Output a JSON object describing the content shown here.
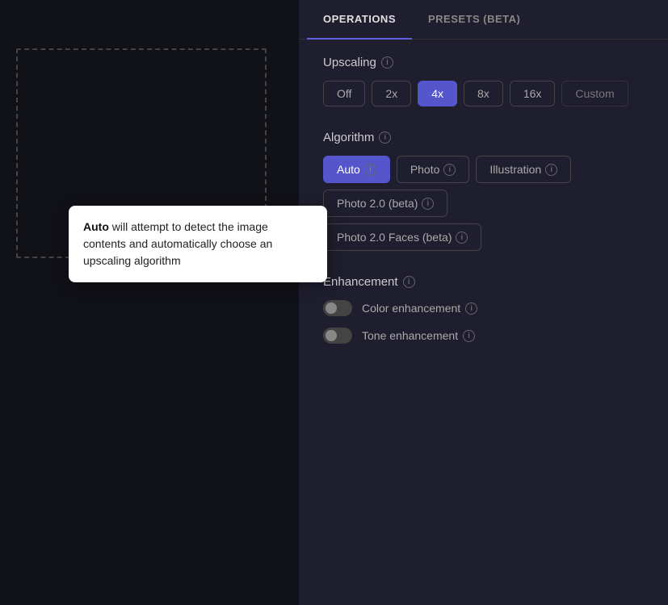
{
  "tabs": {
    "operations": {
      "label": "OPERATIONS",
      "active": true
    },
    "presets": {
      "label": "PRESETS (BETA)",
      "active": false
    }
  },
  "upscaling": {
    "title": "Upscaling",
    "options": [
      {
        "label": "Off",
        "active": false
      },
      {
        "label": "2x",
        "active": false
      },
      {
        "label": "4x",
        "active": true
      },
      {
        "label": "8x",
        "active": false
      },
      {
        "label": "16x",
        "active": false
      },
      {
        "label": "Custom",
        "active": false,
        "muted": true
      }
    ]
  },
  "algorithm": {
    "title": "Algorithm",
    "row1": [
      {
        "label": "Auto",
        "active": true,
        "has_info": true
      },
      {
        "label": "Photo",
        "active": false,
        "has_info": true
      },
      {
        "label": "Illustration",
        "active": false,
        "has_info": true
      }
    ],
    "row2": [
      {
        "label": "Photo 2.0 (beta)",
        "active": false,
        "has_info": true
      }
    ],
    "row3": [
      {
        "label": "Photo 2.0 Faces (beta)",
        "active": false,
        "has_info": true
      }
    ]
  },
  "enhancement": {
    "title": "Enhancement",
    "options": [
      {
        "label": "Color enhancement",
        "active": false,
        "has_info": true
      },
      {
        "label": "Tone enhancement",
        "active": false,
        "has_info": true
      }
    ]
  },
  "tooltip": {
    "bold_text": "Auto",
    "text": " will attempt to detect the image contents and automatically choose an upscaling algorithm"
  }
}
